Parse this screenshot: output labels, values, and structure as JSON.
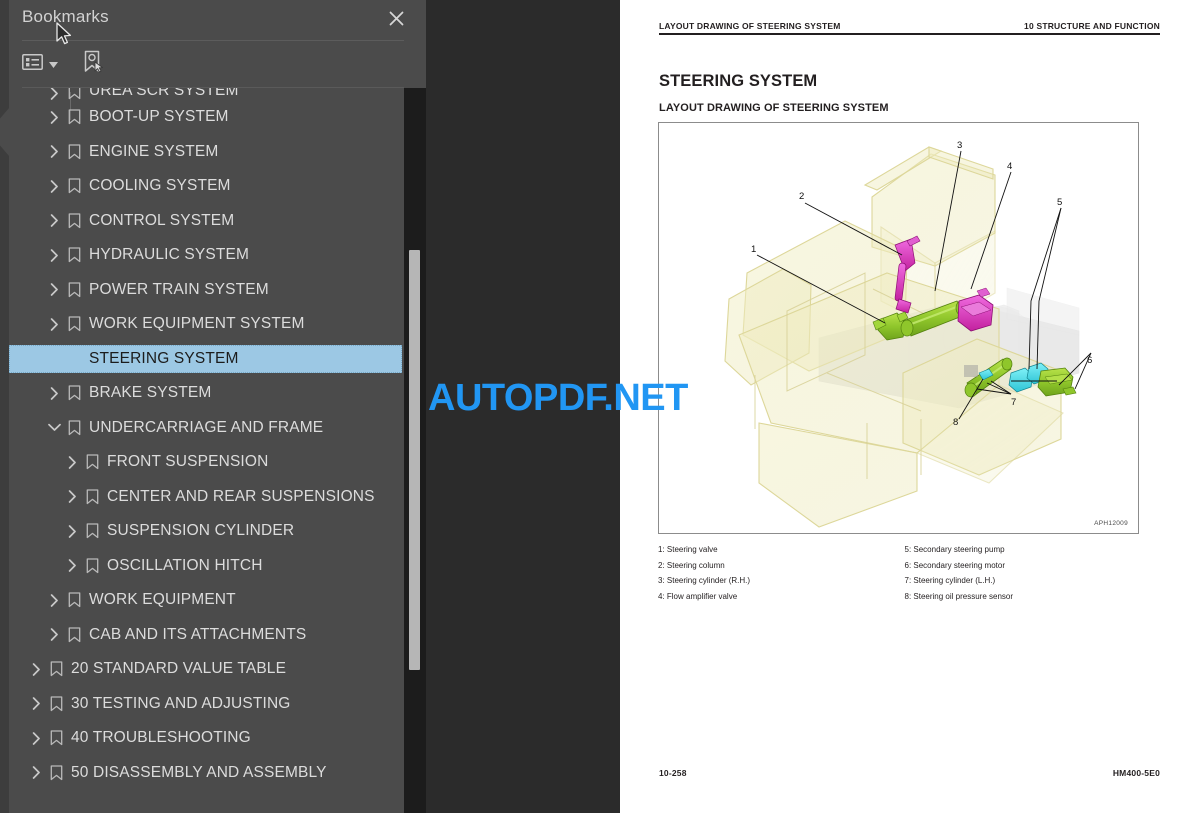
{
  "panel": {
    "title": "Bookmarks",
    "close_icon": "close-icon",
    "toolbar": {
      "options_label": "Bookmark options",
      "options_icon": "list-options-icon",
      "caret_icon": "chevron-down-icon",
      "new_bookmark_label": "New bookmark",
      "new_bookmark_icon": "new-bookmark-icon"
    },
    "selection_color": "#9cc8e4",
    "background_color": "#4b4b4b",
    "tree": [
      {
        "label": "UREA SCR SYSTEM",
        "depth": 0,
        "state": "collapsed",
        "clipped": true,
        "selected": false
      },
      {
        "label": "BOOT-UP SYSTEM",
        "depth": 0,
        "state": "collapsed",
        "clipped": false,
        "selected": false
      },
      {
        "label": "ENGINE SYSTEM",
        "depth": 0,
        "state": "collapsed",
        "clipped": false,
        "selected": false
      },
      {
        "label": "COOLING SYSTEM",
        "depth": 0,
        "state": "collapsed",
        "clipped": false,
        "selected": false
      },
      {
        "label": "CONTROL SYSTEM",
        "depth": 0,
        "state": "collapsed",
        "clipped": false,
        "selected": false
      },
      {
        "label": "HYDRAULIC SYSTEM",
        "depth": 0,
        "state": "collapsed",
        "clipped": false,
        "selected": false
      },
      {
        "label": "POWER TRAIN SYSTEM",
        "depth": 0,
        "state": "collapsed",
        "clipped": false,
        "selected": false
      },
      {
        "label": "WORK EQUIPMENT SYSTEM",
        "depth": 0,
        "state": "collapsed",
        "clipped": false,
        "selected": false
      },
      {
        "label": "STEERING SYSTEM",
        "depth": 0,
        "state": "collapsed",
        "clipped": false,
        "selected": true
      },
      {
        "label": "BRAKE SYSTEM",
        "depth": 0,
        "state": "collapsed",
        "clipped": false,
        "selected": false
      },
      {
        "label": "UNDERCARRIAGE AND FRAME",
        "depth": 0,
        "state": "expanded",
        "clipped": false,
        "selected": false
      },
      {
        "label": "FRONT SUSPENSION",
        "depth": 1,
        "state": "collapsed",
        "clipped": false,
        "selected": false
      },
      {
        "label": "CENTER AND REAR SUSPENSIONS",
        "depth": 1,
        "state": "collapsed",
        "clipped": false,
        "selected": false
      },
      {
        "label": "SUSPENSION CYLINDER",
        "depth": 1,
        "state": "collapsed",
        "clipped": false,
        "selected": false
      },
      {
        "label": "OSCILLATION HITCH",
        "depth": 1,
        "state": "collapsed",
        "clipped": false,
        "selected": false
      },
      {
        "label": "WORK EQUIPMENT",
        "depth": 0,
        "state": "collapsed",
        "clipped": false,
        "selected": false
      },
      {
        "label": "CAB AND ITS ATTACHMENTS",
        "depth": 0,
        "state": "collapsed",
        "clipped": false,
        "selected": false
      },
      {
        "label": "20 STANDARD VALUE TABLE",
        "depth": -1,
        "state": "collapsed",
        "clipped": false,
        "selected": false
      },
      {
        "label": "30 TESTING AND ADJUSTING",
        "depth": -1,
        "state": "collapsed",
        "clipped": false,
        "selected": false
      },
      {
        "label": "40 TROUBLESHOOTING",
        "depth": -1,
        "state": "collapsed",
        "clipped": false,
        "selected": false
      },
      {
        "label": "50 DISASSEMBLY AND ASSEMBLY",
        "depth": -1,
        "state": "collapsed",
        "clipped": false,
        "selected": false
      }
    ]
  },
  "document": {
    "header_left": "LAYOUT DRAWING OF STEERING SYSTEM",
    "header_right": "10 STRUCTURE AND FUNCTION",
    "heading": "STEERING SYSTEM",
    "subheading": "LAYOUT DRAWING OF STEERING SYSTEM",
    "figure_code": "APH12009",
    "legend": [
      "1: Steering valve",
      "5: Secondary steering pump",
      "2: Steering column",
      "6: Secondary steering motor",
      "3: Steering cylinder (R.H.)",
      "7: Steering cylinder (L.H.)",
      "4: Flow amplifier valve",
      "8: Steering oil pressure sensor"
    ],
    "footer_left": "10-258",
    "footer_right": "HM400-5E0"
  },
  "watermark": {
    "text": "AUTOPDF.NET",
    "color": "#2196f3"
  }
}
